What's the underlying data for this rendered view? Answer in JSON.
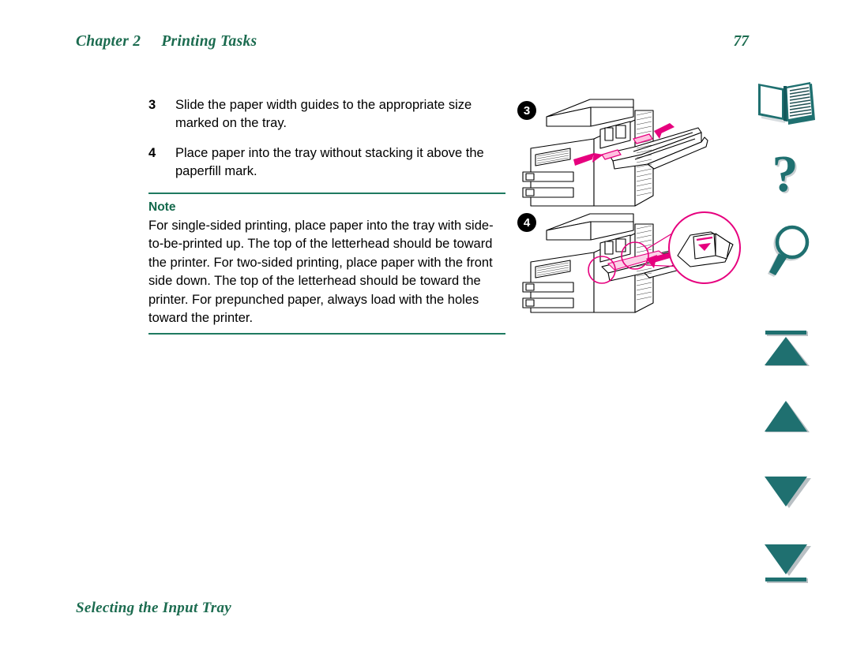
{
  "header": {
    "chapter": "Chapter 2",
    "title": "Printing Tasks",
    "page_number": "77"
  },
  "colors": {
    "heading_green": "#1b6b4f",
    "rule_green": "#1f7a60",
    "note_green": "#14694c",
    "icon_teal": "#1f7070",
    "accent_magenta": "#e6007e",
    "badge_black": "#000000"
  },
  "steps": [
    {
      "number": "3",
      "text": "Slide the paper width guides to the appropriate size marked on the tray."
    },
    {
      "number": "4",
      "text": "Place paper into the tray without stacking it above the paperfill mark."
    }
  ],
  "note": {
    "label": "Note",
    "body": "For single-sided printing, place paper into the tray with side-to-be-printed up. The top of the letterhead should be toward the printer. For two-sided printing, place paper with the front side down. The top of the letterhead should be toward the printer. For prepunched paper, always load with the holes toward the printer."
  },
  "illustrations": [
    {
      "badge": "3",
      "caption": "printer-tray-width-guides"
    },
    {
      "badge": "4",
      "caption": "printer-tray-paperfill-mark"
    }
  ],
  "icon_rail": [
    {
      "name": "book-icon",
      "label": "Contents"
    },
    {
      "name": "question-icon",
      "label": "Help"
    },
    {
      "name": "magnifier-icon",
      "label": "Search"
    },
    {
      "name": "first-page-icon",
      "label": "First page"
    },
    {
      "name": "previous-page-icon",
      "label": "Previous page"
    },
    {
      "name": "next-page-icon",
      "label": "Next page"
    },
    {
      "name": "last-page-icon",
      "label": "Last page"
    }
  ],
  "footer": {
    "title": "Selecting the Input Tray"
  }
}
